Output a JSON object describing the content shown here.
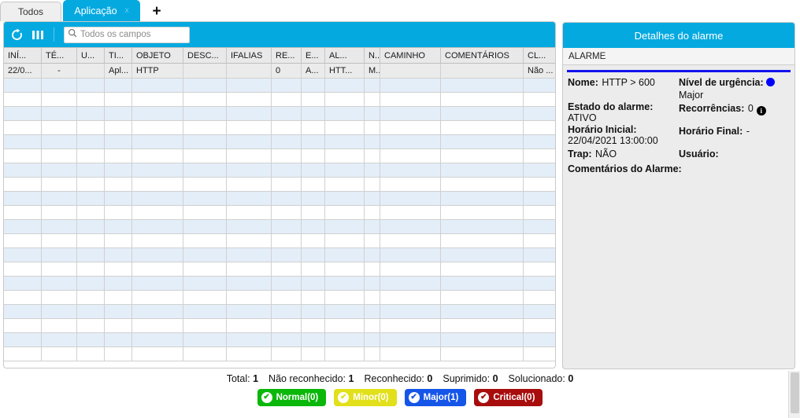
{
  "tabs": [
    {
      "label": "Todos",
      "active": false,
      "closable": false
    },
    {
      "label": "Aplicação",
      "active": true,
      "closable": true,
      "close_label": "x"
    }
  ],
  "tab_add_label": "+",
  "toolbar": {
    "refresh_icon": "refresh-icon",
    "columns_icon": "columns-icon",
    "search_placeholder": "Todos os campos",
    "search_value": "",
    "accent_color": "#04a9e0"
  },
  "grid": {
    "columns": [
      {
        "label": "INÍ...",
        "width": 48
      },
      {
        "label": "TÉ...",
        "width": 45
      },
      {
        "label": "U...",
        "width": 35
      },
      {
        "label": "TI...",
        "width": 35
      },
      {
        "label": "OBJETO",
        "width": 65
      },
      {
        "label": "DESC...",
        "width": 55
      },
      {
        "label": "IFALIAS",
        "width": 57
      },
      {
        "label": "RE...",
        "width": 38
      },
      {
        "label": "E...",
        "width": 30
      },
      {
        "label": "AL...",
        "width": 50
      },
      {
        "label": "N...",
        "width": 20
      },
      {
        "label": "CAMINHO",
        "width": 77
      },
      {
        "label": "COMENTÁRIOS",
        "width": 105
      },
      {
        "label": "CL...",
        "width": 46
      }
    ],
    "rows": [
      [
        "22/0...",
        "-",
        "",
        "Apl...",
        "HTTP",
        "",
        "",
        "0",
        "A...",
        "HTT...",
        "M...",
        "",
        "",
        "Não ..."
      ]
    ],
    "empty_row_count": 20
  },
  "details": {
    "title": "Detalhes do alarme",
    "section": "ALARME",
    "rule_color": "#1313ee",
    "fields": [
      {
        "label": "Nome:",
        "value": "HTTP > 600"
      },
      {
        "label": "Nível de urgência:",
        "value": "Major",
        "dot_color": "#0000ff",
        "icon": "severity-dot-icon"
      },
      {
        "label": "Estado do alarme:",
        "value": "ATIVO"
      },
      {
        "label": "Recorrências:",
        "value": "0",
        "icon": "info-icon"
      },
      {
        "label": "Horário Inicial:",
        "value": "22/04/2021 13:00:00"
      },
      {
        "label": "Horário Final:",
        "value": "-"
      },
      {
        "label": "Trap:",
        "value": "NÃO"
      },
      {
        "label": "Usuário:",
        "value": ""
      },
      {
        "label": "Comentários do Alarme:",
        "value": ""
      }
    ]
  },
  "footer": {
    "counts": [
      {
        "label": "Total:",
        "value": "1"
      },
      {
        "label": "Não reconhecido:",
        "value": "1"
      },
      {
        "label": "Reconhecido:",
        "value": "0"
      },
      {
        "label": "Suprimido:",
        "value": "0"
      },
      {
        "label": "Solucionado:",
        "value": "0"
      }
    ],
    "badges": [
      {
        "label": "Normal(0)",
        "color": "#0ab70a",
        "check_color": "#0ab70a"
      },
      {
        "label": "Minor(0)",
        "color": "#e2e01a",
        "check_color": "#e2e01a"
      },
      {
        "label": "Major(1)",
        "color": "#1555e8",
        "check_color": "#1555e8"
      },
      {
        "label": "Critical(0)",
        "color": "#a80d0d",
        "check_color": "#a80d0d"
      }
    ],
    "check_glyph": "✔"
  }
}
